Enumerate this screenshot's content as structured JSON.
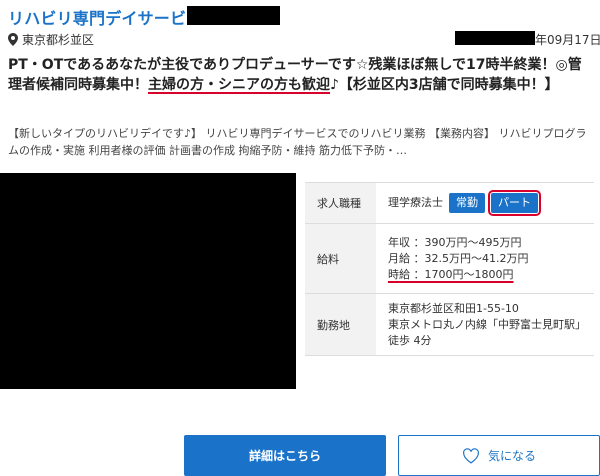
{
  "job": {
    "company": "リハビリ専門デイサービス",
    "location": "東京都杉並区",
    "date": "年09月17日",
    "headline_part1": "PT・OTであるあなたが主役でありプロデューサーです☆残業ほぼ無しで17時半終業！◎管理者候補同時募集中！",
    "headline_highlight": "主婦の方・シニアの方も歓迎",
    "headline_part2": "♪【杉並区内3店舗で同時募集中！】",
    "description": "【新しいタイプのリハビリデイです♪】 リハビリ専門デイサービスでのリハビリ業務 【業務内容】 リハビリプログラムの作成・実施 利用者様の評価 計画書の作成 拘縮予防・維持 筋力低下予防・…"
  },
  "table": {
    "type_label": "求人職種",
    "type_value": "理学療法士",
    "tag_fulltime": "常勤",
    "tag_parttime": "パート",
    "salary_label": "給料",
    "salary_annual": "年収 ：390万円〜495万円",
    "salary_monthly": "月給 ：32.5万円〜41.2万円",
    "salary_hourly": "時給 ：1700円〜1800円",
    "workplace_label": "勤務地",
    "address": "東京都杉並区和田1-55-10",
    "access": "東京メトロ丸ノ内線「中野富士見町駅」徒歩 4分"
  },
  "buttons": {
    "detail": "詳細はこちら",
    "favorite": "気になる"
  },
  "colors": {
    "accent": "#1a73c8",
    "highlight": "#d9002b"
  }
}
